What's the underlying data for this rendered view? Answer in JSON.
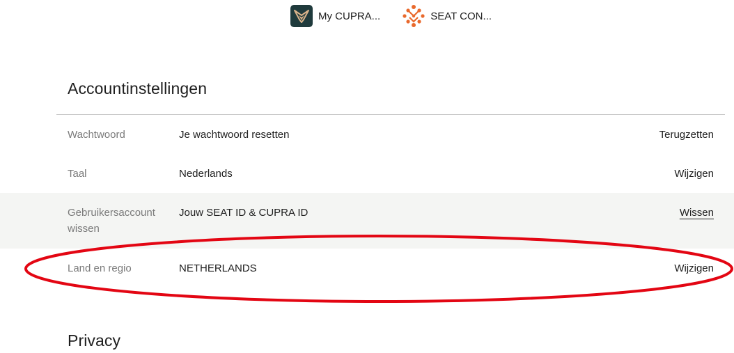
{
  "apps": [
    {
      "name": "My CUPRA...",
      "icon": "cupra-logo-icon"
    },
    {
      "name": "SEAT CON...",
      "icon": "seat-connect-logo-icon"
    }
  ],
  "account_settings": {
    "title": "Accountinstellingen",
    "rows": [
      {
        "label": "Wachtwoord",
        "value": "Je wachtwoord resetten",
        "action": "Terugzetten"
      },
      {
        "label": "Taal",
        "value": "Nederlands",
        "action": "Wijzigen"
      },
      {
        "label": "Gebruikersaccount wissen",
        "value": "Jouw SEAT ID & CUPRA ID",
        "action": "Wissen"
      },
      {
        "label": "Land en regio",
        "value": "NETHERLANDS",
        "action": "Wijzigen"
      }
    ]
  },
  "privacy": {
    "title": "Privacy"
  },
  "colors": {
    "cupra_tile": "#1f3a3c",
    "cupra_accent": "#d8b28a",
    "seat_connect": "#e9692c",
    "highlight_ellipse": "#e30613",
    "shaded_row": "#f4f5f3"
  }
}
